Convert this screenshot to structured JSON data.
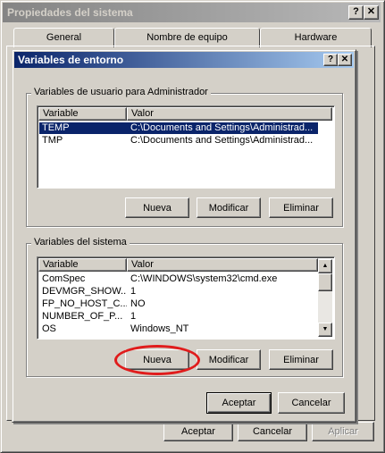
{
  "outer_window": {
    "title": "Propiedades del sistema",
    "tabs": [
      "General",
      "Nombre de equipo",
      "Hardware"
    ],
    "buttons": {
      "ok": "Aceptar",
      "cancel": "Cancelar",
      "apply": "Aplicar"
    }
  },
  "caption_buttons": {
    "help": "?",
    "close": "✕"
  },
  "dialog": {
    "title": "Variables de entorno",
    "user_group": {
      "label": "Variables de usuario para Administrador",
      "columns": [
        "Variable",
        "Valor"
      ],
      "rows": [
        {
          "variable": "TEMP",
          "value": "C:\\Documents and Settings\\Administrad...",
          "selected": true
        },
        {
          "variable": "TMP",
          "value": "C:\\Documents and Settings\\Administrad...",
          "selected": false
        }
      ],
      "buttons": {
        "new": "Nueva",
        "edit": "Modificar",
        "delete": "Eliminar"
      }
    },
    "system_group": {
      "label": "Variables del sistema",
      "columns": [
        "Variable",
        "Valor"
      ],
      "rows": [
        {
          "variable": "ComSpec",
          "value": "C:\\WINDOWS\\system32\\cmd.exe"
        },
        {
          "variable": "DEVMGR_SHOW...",
          "value": "1"
        },
        {
          "variable": "FP_NO_HOST_C...",
          "value": "NO"
        },
        {
          "variable": "NUMBER_OF_P...",
          "value": "1"
        },
        {
          "variable": "OS",
          "value": "Windows_NT"
        }
      ],
      "buttons": {
        "new": "Nueva",
        "edit": "Modificar",
        "delete": "Eliminar"
      }
    },
    "buttons": {
      "ok": "Aceptar",
      "cancel": "Cancelar"
    }
  },
  "scroll_arrows": {
    "up": "▲",
    "down": "▼"
  },
  "colors": {
    "face": "#d4d0c8",
    "active_title": "#0a246a",
    "inactive_title": "#848484",
    "selection": "#0a246a",
    "highlight_ellipse": "#e01c1c"
  }
}
